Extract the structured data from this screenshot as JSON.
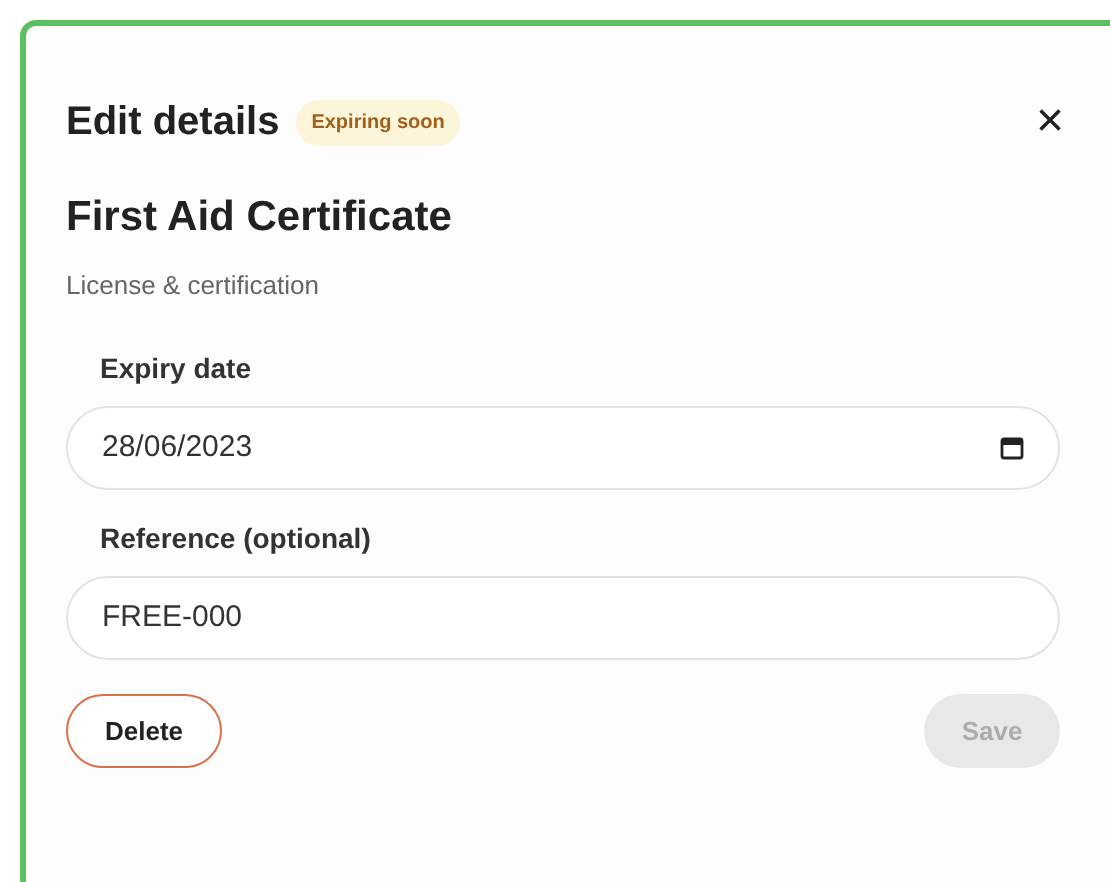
{
  "dialog": {
    "title": "Edit details",
    "badge": "Expiring soon",
    "close": "×"
  },
  "record": {
    "name": "First Aid Certificate",
    "category": "License & certification"
  },
  "fields": [
    {
      "kind": "date",
      "label": "Expiry date",
      "value": "28/06/2023"
    },
    {
      "kind": "text",
      "label": "Reference (optional)",
      "value": "FREE-000"
    }
  ],
  "buttons": [
    {
      "kind": "delete",
      "label": "Delete",
      "disabled": false
    },
    {
      "kind": "save",
      "label": "Save",
      "disabled": true
    }
  ]
}
